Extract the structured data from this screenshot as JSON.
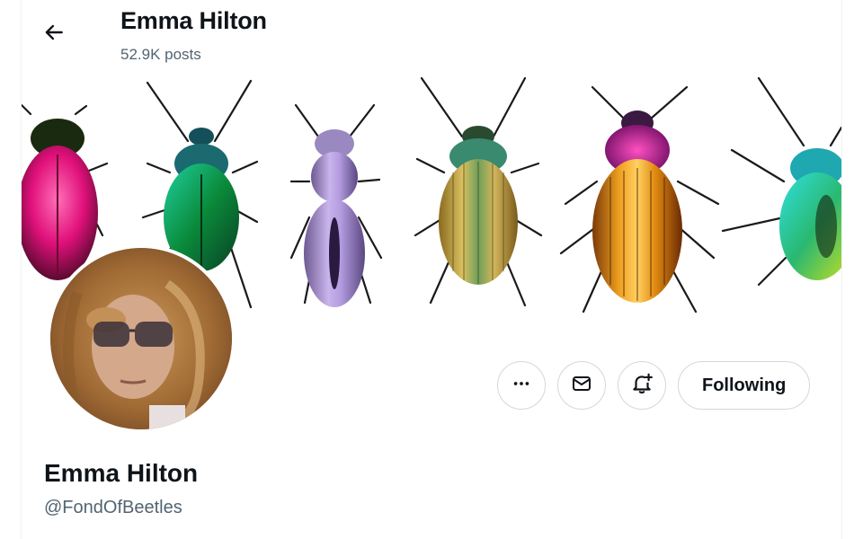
{
  "header": {
    "title": "Emma Hilton",
    "posts_count": "52.9K posts",
    "back_icon": "arrow-left-icon"
  },
  "banner": {
    "description_icon": "beetles-banner"
  },
  "profile": {
    "display_name": "Emma Hilton",
    "handle": "@FondOfBeetles"
  },
  "actions": {
    "more_icon": "more-icon",
    "message_icon": "envelope-icon",
    "notify_icon": "bell-plus-icon",
    "follow_label": "Following"
  },
  "colors": {
    "text_primary": "#0f1419",
    "text_secondary": "#536471",
    "border": "#cfd9de"
  }
}
